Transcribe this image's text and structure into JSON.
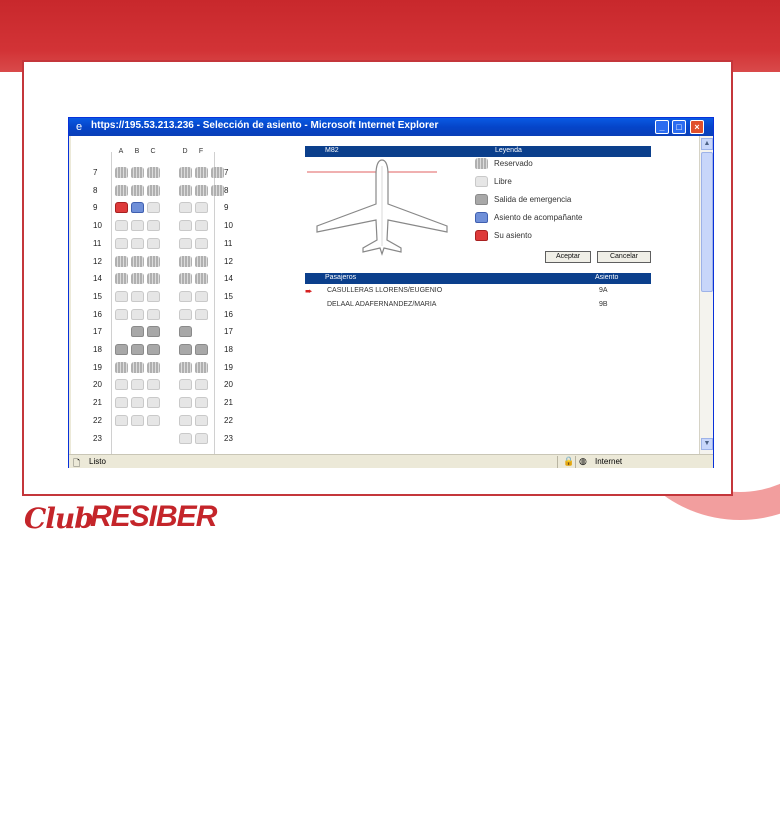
{
  "window": {
    "title": "https://195.53.213.236 - Selección de asiento - Microsoft Internet Explorer",
    "status": "Listo",
    "zone": "Internet"
  },
  "seatmap": {
    "columns": [
      "A",
      "B",
      "C",
      "D",
      "F"
    ],
    "rows": [
      {
        "num": "7",
        "seats": [
          "r",
          "r",
          "r",
          "r",
          "r",
          "r"
        ]
      },
      {
        "num": "8",
        "seats": [
          "r",
          "r",
          "r",
          "r",
          "r",
          "r"
        ]
      },
      {
        "num": "9",
        "seats": [
          "s",
          "c",
          "l",
          "l",
          "l",
          "-"
        ]
      },
      {
        "num": "10",
        "seats": [
          "l",
          "l",
          "l",
          "l",
          "l",
          "-"
        ]
      },
      {
        "num": "11",
        "seats": [
          "l",
          "l",
          "l",
          "l",
          "l",
          "-"
        ]
      },
      {
        "num": "12",
        "seats": [
          "r",
          "r",
          "r",
          "r",
          "r",
          "-"
        ]
      },
      {
        "num": "14",
        "seats": [
          "r",
          "r",
          "r",
          "r",
          "r",
          "-"
        ]
      },
      {
        "num": "15",
        "seats": [
          "l",
          "l",
          "l",
          "l",
          "l",
          "-"
        ]
      },
      {
        "num": "16",
        "seats": [
          "l",
          "l",
          "l",
          "l",
          "l",
          "-"
        ]
      },
      {
        "num": "17",
        "seats": [
          "-",
          "e",
          "e",
          "e",
          "-",
          "-"
        ]
      },
      {
        "num": "18",
        "seats": [
          "e",
          "e",
          "e",
          "e",
          "e",
          "-"
        ]
      },
      {
        "num": "19",
        "seats": [
          "r",
          "r",
          "r",
          "r",
          "r",
          "-"
        ]
      },
      {
        "num": "20",
        "seats": [
          "l",
          "l",
          "l",
          "l",
          "l",
          "-"
        ]
      },
      {
        "num": "21",
        "seats": [
          "l",
          "l",
          "l",
          "l",
          "l",
          "-"
        ]
      },
      {
        "num": "22",
        "seats": [
          "l",
          "l",
          "l",
          "l",
          "l",
          "-"
        ]
      },
      {
        "num": "23",
        "seats": [
          "-",
          "-",
          "-",
          "l",
          "l",
          "-"
        ]
      }
    ]
  },
  "panel": {
    "aircraft": "M82",
    "legend_header": "Leyenda",
    "legend": [
      {
        "key": "r",
        "label": "Reservado"
      },
      {
        "key": "l",
        "label": "Libre"
      },
      {
        "key": "e",
        "label": "Salida de emergencia"
      },
      {
        "key": "c",
        "label": "Asiento de acompañante"
      },
      {
        "key": "s",
        "label": "Su asiento"
      }
    ],
    "accept_label": "Aceptar",
    "cancel_label": "Cancelar"
  },
  "passengers": {
    "col_name": "Pasajeros",
    "col_seat": "Asiento",
    "rows": [
      {
        "name": "CASULLERAS LLORENS/EUGENIO",
        "seat": "9A",
        "current": true
      },
      {
        "name": "DELAAL ADAFERNANDEZ/MARIA",
        "seat": "9B",
        "current": false
      }
    ]
  },
  "brand": {
    "logo_club": "Club",
    "logo_resiber": "RESIBER",
    "accent": "#c4252a",
    "ie_blue": "#0a4fd6"
  }
}
